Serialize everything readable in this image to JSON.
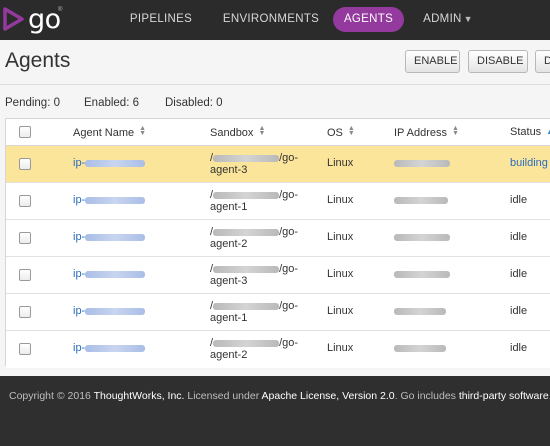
{
  "logo": {
    "text": "go",
    "mark": "®"
  },
  "nav": {
    "pipelines": "PIPELINES",
    "environments": "ENVIRONMENTS",
    "agents": "AGENTS",
    "admin": "ADMIN",
    "active": "AGENTS"
  },
  "header": {
    "title": "Agents",
    "buttons": {
      "enable": "ENABLE",
      "disable": "DISABLE",
      "more": "D"
    }
  },
  "summary": {
    "pending": "Pending: 0",
    "enabled": "Enabled: 6",
    "disabled": "Disabled: 0"
  },
  "table": {
    "columns": {
      "agent_name": "Agent Name",
      "sandbox": "Sandbox",
      "os": "OS",
      "ip_address": "IP Address",
      "status": "Status"
    },
    "sorted_by": "Status",
    "rows": [
      {
        "agent_name": "ip-",
        "sandbox_prefix": "/",
        "sandbox_suffix": "/go-",
        "sandbox_line2": "agent-3",
        "os": "Linux",
        "status": "building",
        "highlighted": true
      },
      {
        "agent_name": "ip-",
        "sandbox_prefix": "/",
        "sandbox_suffix": "/go-",
        "sandbox_line2": "agent-1",
        "os": "Linux",
        "status": "idle",
        "highlighted": false
      },
      {
        "agent_name": "ip-",
        "sandbox_prefix": "/",
        "sandbox_suffix": "/go-",
        "sandbox_line2": "agent-2",
        "os": "Linux",
        "status": "idle",
        "highlighted": false
      },
      {
        "agent_name": "ip-",
        "sandbox_prefix": "/",
        "sandbox_suffix": "/go-",
        "sandbox_line2": "agent-3",
        "os": "Linux",
        "status": "idle",
        "highlighted": false
      },
      {
        "agent_name": "ip-",
        "sandbox_prefix": "/",
        "sandbox_suffix": "/go-",
        "sandbox_line2": "agent-1",
        "os": "Linux",
        "status": "idle",
        "highlighted": false
      },
      {
        "agent_name": "ip-",
        "sandbox_prefix": "/",
        "sandbox_suffix": "/go-",
        "sandbox_line2": "agent-2",
        "os": "Linux",
        "status": "idle",
        "highlighted": false
      }
    ]
  },
  "footer": {
    "copyright": "Copyright © 2016 ",
    "company": "ThoughtWorks, Inc.",
    "licensed": " Licensed under ",
    "license": "Apache License, Version 2.0",
    "includes": ". Go includes ",
    "third_party": "third-party software",
    "end": "."
  },
  "colors": {
    "navbar": "#2b2b2b",
    "active_tab": "#943a9e",
    "building_row": "#fbe59a",
    "link": "#2b6cbf",
    "footer": "#2f2f2f"
  },
  "icons": [
    "go-logo-icon",
    "caret-down-icon",
    "sort-icon",
    "sort-up-icon",
    "checkbox-icon"
  ]
}
